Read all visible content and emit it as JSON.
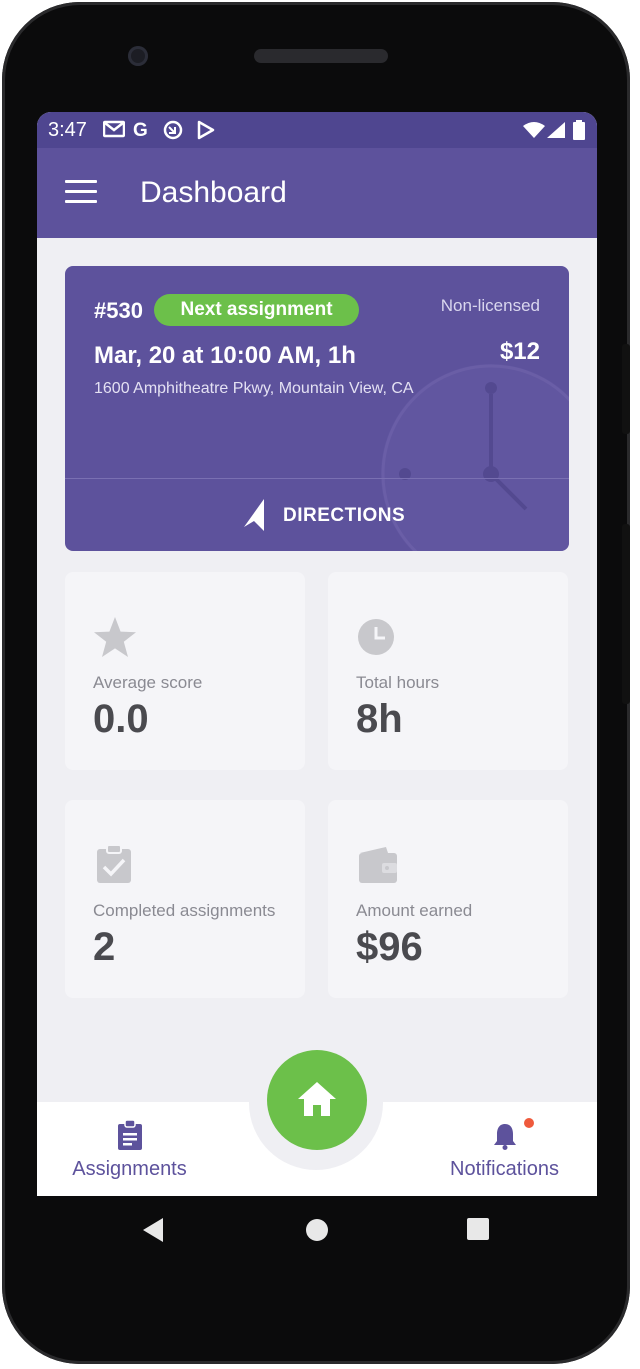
{
  "status_bar": {
    "time": "3:47",
    "notification_icons": [
      "gmail-icon",
      "google-icon",
      "sync-icon",
      "play-store-icon"
    ],
    "system_icons": [
      "wifi-icon",
      "signal-icon",
      "battery-icon"
    ]
  },
  "app_bar": {
    "title": "Dashboard",
    "menu_icon": "hamburger-menu-icon"
  },
  "next_assignment": {
    "number": "#530",
    "badge": "Next assignment",
    "license": "Non-licensed",
    "datetime": "Mar, 20 at 10:00 AM, 1h",
    "price": "$12",
    "address": "1600 Amphitheatre Pkwy, Mountain View, CA",
    "action": "DIRECTIONS"
  },
  "stats": [
    {
      "icon": "star-icon",
      "label": "Average score",
      "value": "0.0"
    },
    {
      "icon": "clock-icon",
      "label": "Total hours",
      "value": "8h"
    },
    {
      "icon": "clipboard-check-icon",
      "label": "Completed assignments",
      "value": "2"
    },
    {
      "icon": "wallet-icon",
      "label": "Amount earned",
      "value": "$96"
    }
  ],
  "bottom_nav": {
    "left": {
      "label": "Assignments",
      "icon": "assignments-icon"
    },
    "center": {
      "icon": "home-icon"
    },
    "right": {
      "label": "Notifications",
      "icon": "bell-icon",
      "has_badge": true
    }
  },
  "colors": {
    "primary": "#5d529c",
    "status_bar": "#4f4690",
    "accent_green": "#6cc04a",
    "background": "#efeff3",
    "card": "#f5f5f8",
    "badge_red": "#ef5a3c"
  }
}
